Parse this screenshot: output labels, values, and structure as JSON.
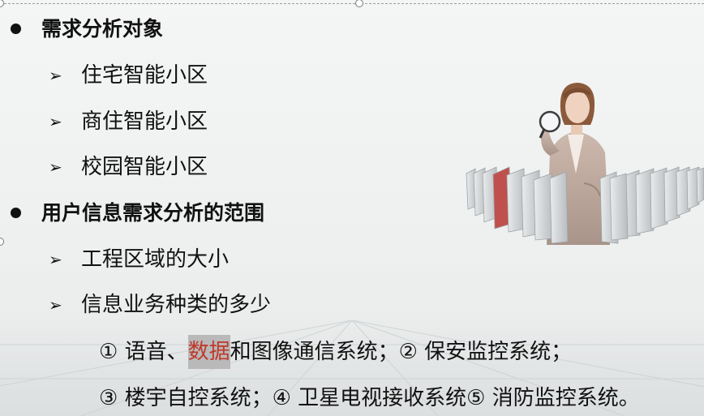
{
  "items": [
    {
      "level": 1,
      "text": "需求分析对象"
    },
    {
      "level": 2,
      "text": "住宅智能小区"
    },
    {
      "level": 2,
      "text": "商住智能小区"
    },
    {
      "level": 2,
      "text": "校园智能小区"
    },
    {
      "level": 1,
      "text": "用户信息需求分析的范围"
    },
    {
      "level": 2,
      "text": "工程区域的大小"
    },
    {
      "level": 2,
      "text": "信息业务种类的多少"
    }
  ],
  "detail_line1": {
    "before": "① 语音、",
    "highlight": "数据",
    "after": "和图像通信系统；② 保安监控系统；"
  },
  "detail_line2": "③ 楼宇自控系统；④ 卫星电视接收系统⑤ 消防监控系统。",
  "bullet_glyph": "➢",
  "colors": {
    "text": "#111111",
    "highlight_text": "#c0392b",
    "highlight_bg": "#b9b9b9",
    "folder_red": "#c0504d",
    "folder_gray": "#d0d3d5"
  },
  "illustration": "woman-with-magnifying-glass-and-folders"
}
